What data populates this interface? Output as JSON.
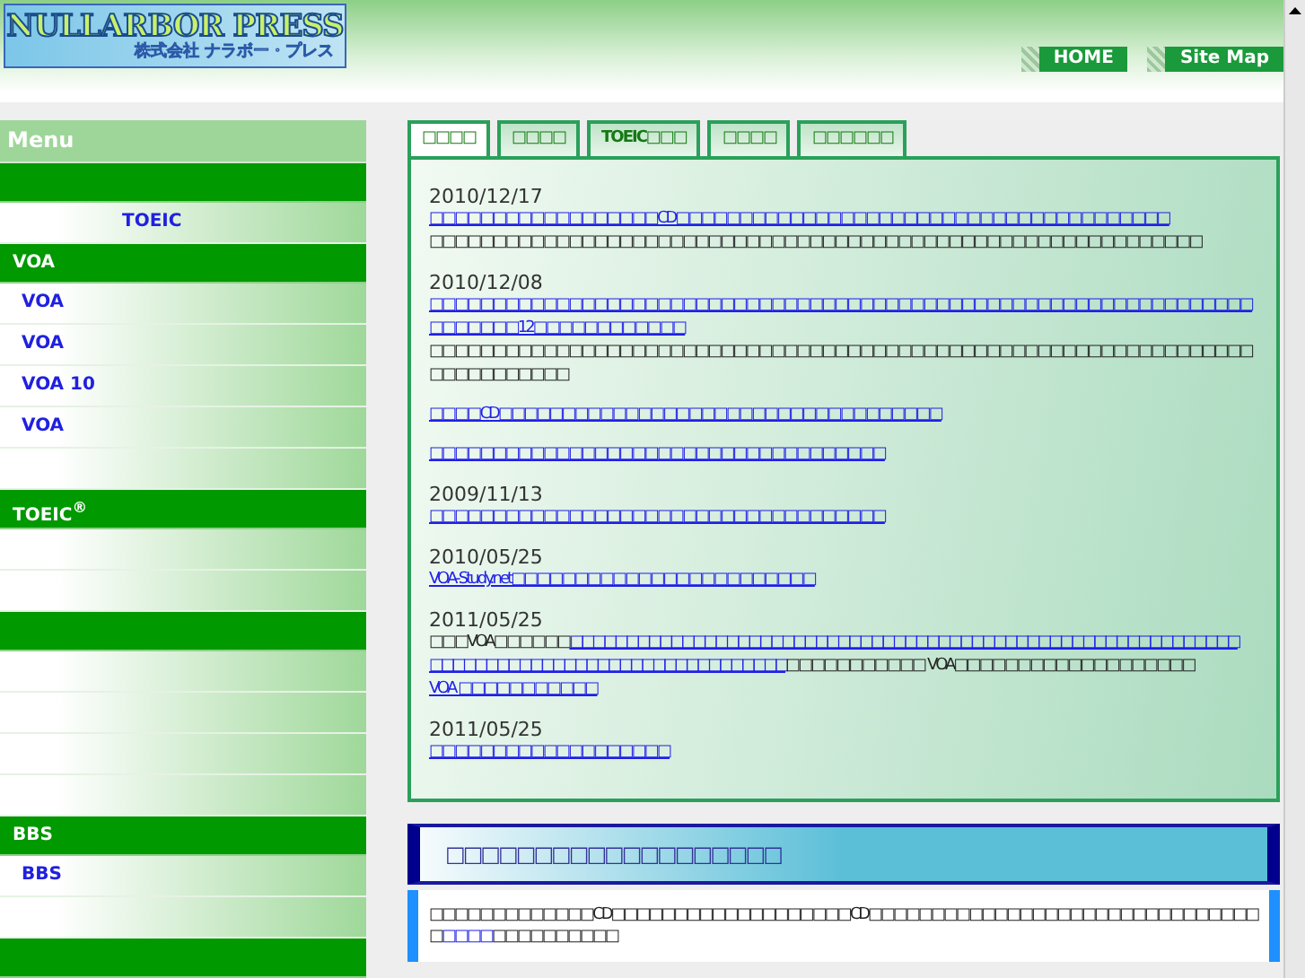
{
  "header": {
    "logo_title": "NULLARBOR PRESS",
    "logo_subtitle": "株式会社 ナラボー・プレス",
    "nav_buttons": [
      "HOME",
      "Site Map"
    ]
  },
  "sidebar": {
    "title": "Menu",
    "items": [
      {
        "kind": "header"
      },
      {
        "kind": "item",
        "label": "TOEIC",
        "indent": true
      },
      {
        "kind": "header",
        "label": "VOA"
      },
      {
        "kind": "item",
        "label": "VOA"
      },
      {
        "kind": "item",
        "label": "VOA"
      },
      {
        "kind": "item",
        "label": "VOA  10"
      },
      {
        "kind": "item",
        "label": "VOA"
      },
      {
        "kind": "item"
      },
      {
        "kind": "header",
        "label": "TOEIC$^{®}$"
      },
      {
        "kind": "item"
      },
      {
        "kind": "item"
      },
      {
        "kind": "header"
      },
      {
        "kind": "item"
      },
      {
        "kind": "item"
      },
      {
        "kind": "item"
      },
      {
        "kind": "item"
      },
      {
        "kind": "header",
        "label": "BBS"
      },
      {
        "kind": "item",
        "label": "BBS"
      },
      {
        "kind": "item"
      },
      {
        "kind": "header"
      }
    ]
  },
  "tabs": [
    {
      "label": "□□□□",
      "selected": true
    },
    {
      "label": "□□□□",
      "selected": false
    },
    {
      "label": "TOEIC□□□",
      "selected": false
    },
    {
      "label": "□□□□",
      "selected": false
    },
    {
      "label": "□□□□□□",
      "selected": false
    }
  ],
  "news": [
    {
      "date": "2010/12/17",
      "paragraphs": [
        [
          {
            "kind": "link",
            "text": "□□□□□□□□□□□□□□□□□□CD□□□□□□□□□□□□□□□□□□□□□□□□□□□□□□□□□□□□□□□"
          }
        ],
        [
          {
            "kind": "plain",
            "text": "□□□□□□□□□□□□□□□□□□□□□□□□□□□□□□□□□□□□□□□□□□□□□□□□□□□□□□□□□□□□□"
          }
        ]
      ]
    },
    {
      "date": "2010/12/08",
      "paragraphs": [
        [
          {
            "kind": "link",
            "text": "□□□□□□□□□□□□□□□□□□□□□□□□□□□□□□□□□□□□□□□□□□□□□□□□□□□□□□□□□□□□□□□□□□□□□□□□12□□□□□□□□□□□□"
          }
        ],
        [
          {
            "kind": "plain",
            "text": "□□□□□□□□□□□□□□□□□□□□□□□□□□□□□□□□□□□□□□□□□□□□□□□□□□□□□□□□□□□□□□□□□□□□□□□□□□□□"
          }
        ]
      ]
    },
    {
      "paragraphs": [
        [
          {
            "kind": "link",
            "text": "□□□□CD□□□□□□□□□□□□□□□□□□□□□□□□□□□□□□□□□□□"
          }
        ]
      ]
    },
    {
      "paragraphs": [
        [
          {
            "kind": "link",
            "text": "□□□□□□□□□□□□□□□□□□□□□□□□□□□□□□□□□□□□"
          }
        ]
      ]
    },
    {
      "date": "2009/11/13",
      "paragraphs": [
        [
          {
            "kind": "link",
            "text": "□□□□□□□□□□□□□□□□□□□□□□□□□□□□□□□□□□□□"
          }
        ]
      ]
    },
    {
      "date": "2010/05/25",
      "paragraphs": [
        [
          {
            "kind": "link",
            "text": "VOA-Study.net□□□□□□□□□□□□□□□□□□□□□□□□"
          }
        ]
      ]
    },
    {
      "date": "2011/05/25",
      "paragraphs": [
        [
          {
            "kind": "plain",
            "text": "□□□VOA□□□□□□"
          },
          {
            "kind": "link",
            "text": "□□□□□□□□□□□□□□□□□□□□□□□□□□□□□□□□□□□□□□□□□□□□□□□□□□□□□□□□□□□□"
          }
        ],
        [
          {
            "kind": "link",
            "text": "□□□□□□□□□□□□□□□□□□□□□□□□□□□□□□□□"
          },
          {
            "kind": "plain",
            "text": "□□□□□□□□□□□ VOA□□□□□□□□□□□□□□□□□□□"
          }
        ],
        [
          {
            "kind": "link",
            "text": "VOA □□□□□□□□□□□"
          }
        ]
      ]
    },
    {
      "date": "2011/05/25",
      "paragraphs": [
        [
          {
            "kind": "link",
            "text": "□□□□□□□□□□□□□□□□□□□"
          }
        ]
      ]
    }
  ],
  "section": {
    "title": "□□□□□□□□□□□□□□□□□□□",
    "paragraph": [
      {
        "kind": "plain",
        "text": "□□□□□□□□□□□□□CD□□□□□□□□□□□□□□□□□□□CD□□□□□□□□□□□□□□□□□□□□□□□□□□□□□□□□"
      },
      {
        "kind": "link",
        "text": "□□□□"
      },
      {
        "kind": "plain",
        "text": "□□□□□□□□□□"
      }
    ]
  }
}
